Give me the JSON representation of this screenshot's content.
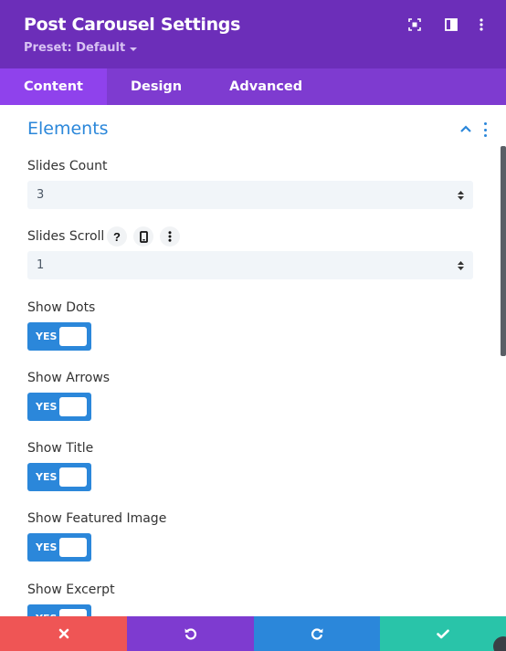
{
  "header": {
    "title": "Post Carousel Settings",
    "preset_label": "Preset: Default",
    "colors": {
      "bg": "#6c2eb9",
      "tabs_bg": "#7e3bd0",
      "active_tab": "#8f42ec"
    }
  },
  "tabs": [
    {
      "label": "Content",
      "active": true
    },
    {
      "label": "Design",
      "active": false
    },
    {
      "label": "Advanced",
      "active": false
    }
  ],
  "section": {
    "title": "Elements",
    "expanded": true,
    "accent": "#2b87da"
  },
  "fields": {
    "slides_count": {
      "label": "Slides Count",
      "value": "3"
    },
    "slides_scroll": {
      "label": "Slides Scroll",
      "value": "1",
      "help_icon": "?"
    },
    "show_dots": {
      "label": "Show Dots",
      "state": "YES"
    },
    "show_arrows": {
      "label": "Show Arrows",
      "state": "YES"
    },
    "show_title": {
      "label": "Show Title",
      "state": "YES"
    },
    "show_featured_image": {
      "label": "Show Featured Image",
      "state": "YES"
    },
    "show_excerpt": {
      "label": "Show Excerpt",
      "state": "YES"
    }
  },
  "footer": {
    "buttons": [
      {
        "name": "cancel",
        "icon": "close-icon",
        "color": "#ef5555"
      },
      {
        "name": "undo",
        "icon": "undo-icon",
        "color": "#7e3bd0"
      },
      {
        "name": "redo",
        "icon": "redo-icon",
        "color": "#2b87da"
      },
      {
        "name": "save",
        "icon": "check-icon",
        "color": "#29c4a9"
      }
    ]
  }
}
